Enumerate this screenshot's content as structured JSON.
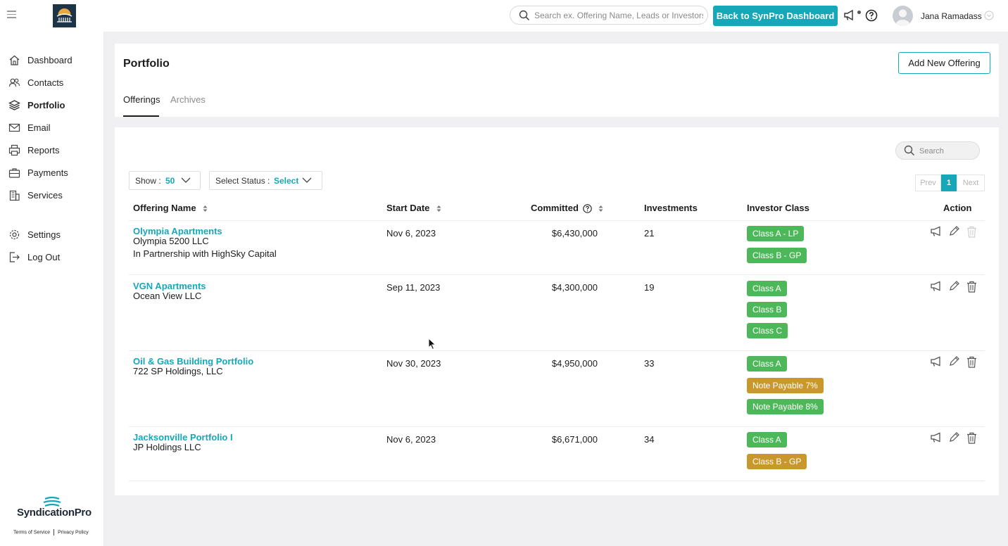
{
  "header": {
    "search_placeholder": "Search ex. Offering Name, Leads or Investors",
    "back_button": "Back to SynPro Dashboard",
    "user_name": "Jana Ramadass"
  },
  "sidebar": {
    "items": [
      {
        "label": "Dashboard",
        "icon": "home-icon"
      },
      {
        "label": "Contacts",
        "icon": "contacts-icon"
      },
      {
        "label": "Portfolio",
        "icon": "layers-icon",
        "active": true
      },
      {
        "label": "Email",
        "icon": "mail-icon"
      },
      {
        "label": "Reports",
        "icon": "printer-icon"
      },
      {
        "label": "Payments",
        "icon": "briefcase-icon"
      },
      {
        "label": "Services",
        "icon": "building-icon"
      },
      {
        "label": "Settings",
        "icon": "gear-icon"
      },
      {
        "label": "Log Out",
        "icon": "logout-icon"
      }
    ],
    "brand": "SyndicationPro",
    "terms": "Terms of Service",
    "privacy": "Privacy Policy"
  },
  "page": {
    "title": "Portfolio",
    "add_button": "Add New Offering",
    "tabs": [
      {
        "label": "Offerings",
        "active": true
      },
      {
        "label": "Archives",
        "active": false
      }
    ]
  },
  "controls": {
    "search_placeholder": "Search",
    "show_label": "Show :",
    "show_value": "50",
    "status_label": "Select Status :",
    "status_value": "Select",
    "pager": {
      "prev": "Prev",
      "current": "1",
      "next": "Next"
    }
  },
  "table": {
    "columns": [
      "Offering Name",
      "Start Date",
      "Committed",
      "Investments",
      "Investor Class",
      "Action"
    ],
    "rows": [
      {
        "name": "Olympia Apartments",
        "entity": "Olympia 5200 LLC",
        "note": "In Partnership with HighSky Capital",
        "start_date": "Nov 6, 2023",
        "committed": "$6,430,000",
        "investments": "21",
        "classes": [
          "Class A - LP",
          "Class B - GP"
        ]
      },
      {
        "name": "VGN Apartments",
        "entity": "Ocean View LLC",
        "start_date": "Sep 11, 2023",
        "committed": "$4,300,000",
        "investments": "19",
        "classes": [
          "Class A",
          "Class B",
          "Class C"
        ]
      },
      {
        "name": "Oil & Gas Building Portfolio",
        "entity": "722 SP Holdings, LLC",
        "start_date": "Nov 30, 2023",
        "committed": "$4,950,000",
        "investments": "33",
        "classes": [
          "Class A",
          "Note Payable 7%",
          "Note Payable 8%"
        ]
      },
      {
        "name": "Jacksonville Portfolio I",
        "entity": "JP Holdings LLC",
        "start_date": "Nov 6, 2023",
        "committed": "$6,671,000",
        "investments": "34",
        "classes": [
          "Class A",
          "Class B - GP"
        ]
      }
    ]
  },
  "colors": {
    "accent": "#16a7b9",
    "badge_green": "#4db85a",
    "badge_gold": "#c9982c"
  }
}
